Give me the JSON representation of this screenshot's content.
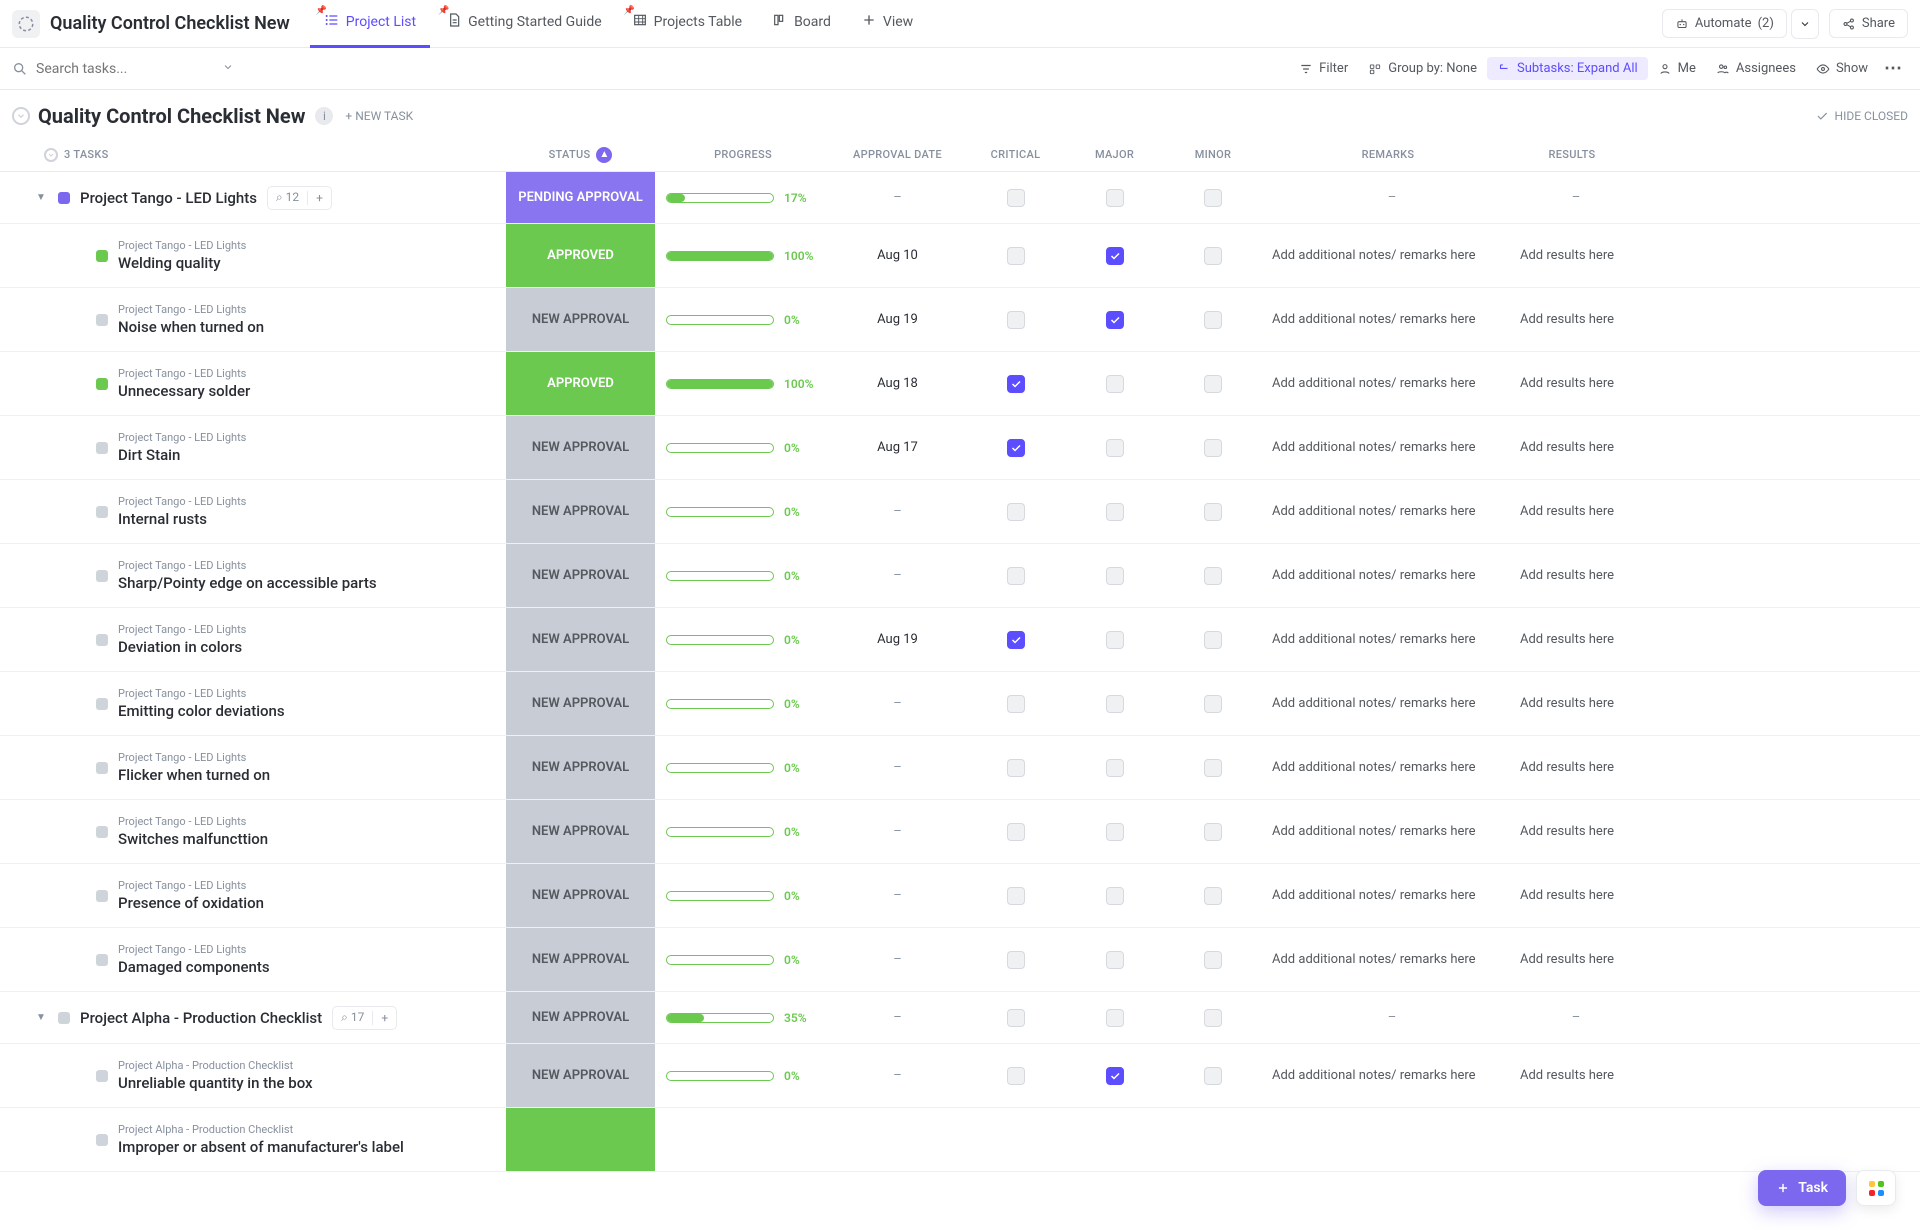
{
  "header": {
    "title": "Quality Control Checklist New",
    "tabs": [
      {
        "label": "Project List",
        "icon": "list-icon",
        "active": true,
        "pinned": true
      },
      {
        "label": "Getting Started Guide",
        "icon": "doc-icon",
        "active": false,
        "pinned": true
      },
      {
        "label": "Projects Table",
        "icon": "table-icon",
        "active": false,
        "pinned": true
      },
      {
        "label": "Board",
        "icon": "board-icon",
        "active": false,
        "pinned": false
      },
      {
        "label": "View",
        "icon": "plus-icon",
        "active": false,
        "pinned": false
      }
    ],
    "automate_label": "Automate",
    "automate_count": "(2)",
    "share_label": "Share"
  },
  "toolbar": {
    "search_placeholder": "Search tasks...",
    "filter": "Filter",
    "group_by": "Group by: None",
    "subtasks": "Subtasks: Expand All",
    "me": "Me",
    "assignees": "Assignees",
    "show": "Show"
  },
  "list": {
    "title": "Quality Control Checklist New",
    "new_task": "+ NEW TASK",
    "hide_closed": "HIDE CLOSED",
    "task_count": "3 TASKS",
    "columns": [
      "STATUS",
      "PROGRESS",
      "APPROVAL DATE",
      "CRITICAL",
      "MAJOR",
      "MINOR",
      "REMARKS",
      "RESULTS"
    ]
  },
  "groups": [
    {
      "name": "Project Tango - LED Lights",
      "subtask_count": "12",
      "status": "PENDING APPROVAL",
      "status_class": "pending",
      "square": "purple",
      "progress": 17,
      "approval_date": "–",
      "critical": false,
      "major": false,
      "minor": false,
      "remarks": "–",
      "results": "–",
      "children": [
        {
          "name": "Welding quality",
          "status": "APPROVED",
          "status_class": "approved",
          "square": "green",
          "progress": 100,
          "approval_date": "Aug 10",
          "critical": false,
          "major": true,
          "minor": false,
          "remarks": "Add additional notes/ remarks here",
          "results": "Add results here"
        },
        {
          "name": "Noise when turned on",
          "status": "NEW APPROVAL",
          "status_class": "new",
          "square": "gray",
          "progress": 0,
          "approval_date": "Aug 19",
          "critical": false,
          "major": true,
          "minor": false,
          "remarks": "Add additional notes/ remarks here",
          "results": "Add results here"
        },
        {
          "name": "Unnecessary solder",
          "status": "APPROVED",
          "status_class": "approved",
          "square": "green",
          "progress": 100,
          "approval_date": "Aug 18",
          "critical": true,
          "major": false,
          "minor": false,
          "remarks": "Add additional notes/ remarks here",
          "results": "Add results here"
        },
        {
          "name": "Dirt Stain",
          "status": "NEW APPROVAL",
          "status_class": "new",
          "square": "gray",
          "progress": 0,
          "approval_date": "Aug 17",
          "critical": true,
          "major": false,
          "minor": false,
          "remarks": "Add additional notes/ remarks here",
          "results": "Add results here"
        },
        {
          "name": "Internal rusts",
          "status": "NEW APPROVAL",
          "status_class": "new",
          "square": "gray",
          "progress": 0,
          "approval_date": "–",
          "critical": false,
          "major": false,
          "minor": false,
          "remarks": "Add additional notes/ remarks here",
          "results": "Add results here"
        },
        {
          "name": "Sharp/Pointy edge on accessible parts",
          "status": "NEW APPROVAL",
          "status_class": "new",
          "square": "gray",
          "progress": 0,
          "approval_date": "–",
          "critical": false,
          "major": false,
          "minor": false,
          "remarks": "Add additional notes/ remarks here",
          "results": "Add results here"
        },
        {
          "name": "Deviation in colors",
          "status": "NEW APPROVAL",
          "status_class": "new",
          "square": "gray",
          "progress": 0,
          "approval_date": "Aug 19",
          "critical": true,
          "major": false,
          "minor": false,
          "remarks": "Add additional notes/ remarks here",
          "results": "Add results here"
        },
        {
          "name": "Emitting color deviations",
          "status": "NEW APPROVAL",
          "status_class": "new",
          "square": "gray",
          "progress": 0,
          "approval_date": "–",
          "critical": false,
          "major": false,
          "minor": false,
          "remarks": "Add additional notes/ remarks here",
          "results": "Add results here"
        },
        {
          "name": "Flicker when turned on",
          "status": "NEW APPROVAL",
          "status_class": "new",
          "square": "gray",
          "progress": 0,
          "approval_date": "–",
          "critical": false,
          "major": false,
          "minor": false,
          "remarks": "Add additional notes/ remarks here",
          "results": "Add results here"
        },
        {
          "name": "Switches malfuncttion",
          "status": "NEW APPROVAL",
          "status_class": "new",
          "square": "gray",
          "progress": 0,
          "approval_date": "–",
          "critical": false,
          "major": false,
          "minor": false,
          "remarks": "Add additional notes/ remarks here",
          "results": "Add results here"
        },
        {
          "name": "Presence of oxidation",
          "status": "NEW APPROVAL",
          "status_class": "new",
          "square": "gray",
          "progress": 0,
          "approval_date": "–",
          "critical": false,
          "major": false,
          "minor": false,
          "remarks": "Add additional notes/ remarks here",
          "results": "Add results here"
        },
        {
          "name": "Damaged components",
          "status": "NEW APPROVAL",
          "status_class": "new",
          "square": "gray",
          "progress": 0,
          "approval_date": "–",
          "critical": false,
          "major": false,
          "minor": false,
          "remarks": "Add additional notes/ remarks here",
          "results": "Add results here"
        }
      ]
    },
    {
      "name": "Project Alpha - Production Checklist",
      "subtask_count": "17",
      "status": "NEW APPROVAL",
      "status_class": "new",
      "square": "gray",
      "progress": 35,
      "approval_date": "–",
      "critical": false,
      "major": false,
      "minor": false,
      "remarks": "–",
      "results": "–",
      "children": [
        {
          "name": "Unreliable quantity in the box",
          "status": "NEW APPROVAL",
          "status_class": "new",
          "square": "gray",
          "progress": 0,
          "approval_date": "–",
          "critical": false,
          "major": true,
          "minor": false,
          "remarks": "Add additional notes/ remarks here",
          "results": "Add results here"
        },
        {
          "name": "Improper or absent of manufacturer's label",
          "status": "",
          "status_class": "approved",
          "square": "gray",
          "progress": null,
          "approval_date": "",
          "critical": null,
          "major": null,
          "minor": null,
          "remarks": "",
          "results": ""
        }
      ]
    }
  ],
  "fab": {
    "label": "Task"
  }
}
